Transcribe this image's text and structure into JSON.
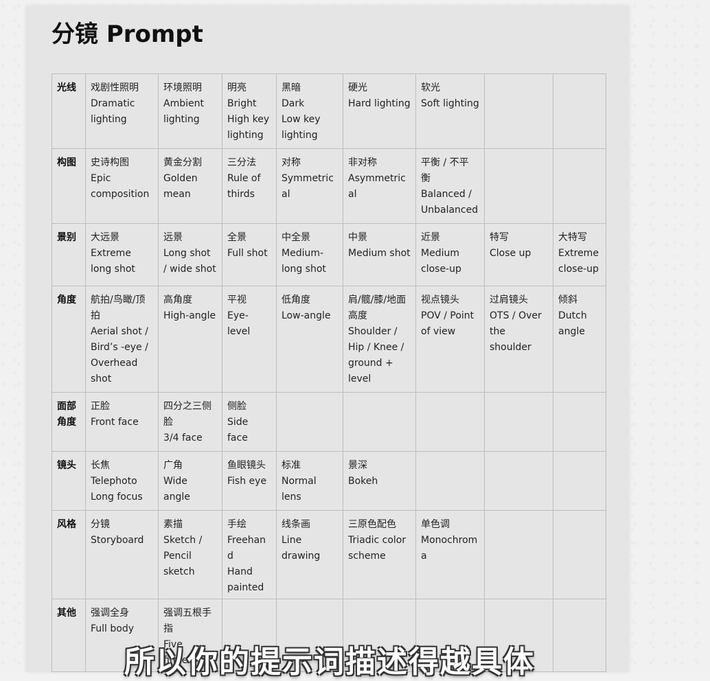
{
  "title": "分镜 Prompt",
  "subtitle": "所以你的提示词描述得越具体",
  "table": {
    "rows": [
      {
        "category": [
          "光线"
        ],
        "cells": [
          [
            "戏剧性照明",
            "Dramatic",
            "lighting"
          ],
          [
            "环境照明",
            "Ambient",
            "lighting"
          ],
          [
            "明亮",
            "Bright",
            "High key",
            "lighting"
          ],
          [
            "黑暗",
            "Dark",
            "Low key",
            "lighting"
          ],
          [
            "硬光",
            "Hard lighting"
          ],
          [
            "软光",
            "Soft lighting"
          ],
          [],
          []
        ]
      },
      {
        "category": [
          "构图"
        ],
        "cells": [
          [
            "史诗构图",
            "Epic",
            "composition"
          ],
          [
            "黄金分割",
            "Golden",
            "mean"
          ],
          [
            "三分法",
            "Rule of",
            "thirds"
          ],
          [
            "对称",
            "Symmetrical"
          ],
          [
            "非对称",
            "Asymmetrical"
          ],
          [
            "平衡 / 不平",
            "衡",
            "Balanced /",
            "Unbalanced"
          ],
          [],
          []
        ]
      },
      {
        "category": [
          "景别"
        ],
        "cells": [
          [
            "大远景",
            "Extreme",
            "long shot"
          ],
          [
            "远景",
            "Long shot",
            "/ wide shot"
          ],
          [
            "全景",
            "Full shot"
          ],
          [
            "中全景",
            "Medium-",
            "long shot"
          ],
          [
            "中景",
            "Medium shot"
          ],
          [
            "近景",
            "Medium",
            "close-up"
          ],
          [
            "特写",
            "Close up"
          ],
          [
            "大特写",
            "Extreme",
            "close-up"
          ]
        ]
      },
      {
        "category": [
          "角度"
        ],
        "cells": [
          [
            "航拍/鸟瞰/顶",
            "拍",
            "Aerial shot /",
            "Bird’s -eye /",
            "Overhead",
            "shot"
          ],
          [
            "高角度",
            "High-angle"
          ],
          [
            "平视",
            "Eye-level"
          ],
          [
            "低角度",
            "Low-angle"
          ],
          [
            "肩/髋/膝/地面",
            "高度",
            "Shoulder /",
            "Hip / Knee /",
            "ground +",
            "level"
          ],
          [
            "视点镜头",
            "POV / Point",
            "of view"
          ],
          [
            "过肩镜头",
            "OTS / Over",
            "the shoulder"
          ],
          [
            "倾斜",
            "Dutch",
            "angle"
          ]
        ]
      },
      {
        "category": [
          "面部",
          "角度"
        ],
        "cells": [
          [
            "正脸",
            "Front face"
          ],
          [
            "四分之三侧",
            "脸",
            "3/4 face"
          ],
          [
            "侧脸",
            "Side face"
          ],
          [],
          [],
          [],
          [],
          []
        ]
      },
      {
        "category": [
          "镜头"
        ],
        "cells": [
          [
            "长焦",
            "Telephoto",
            "Long focus"
          ],
          [
            "广角",
            "Wide angle"
          ],
          [
            "鱼眼镜头",
            "Fish eye"
          ],
          [
            "标准",
            "Normal lens"
          ],
          [
            "景深",
            "Bokeh"
          ],
          [],
          [],
          []
        ]
      },
      {
        "category": [
          "风格"
        ],
        "cells": [
          [
            "分镜",
            "Storyboard"
          ],
          [
            "素描",
            "Sketch /",
            "Pencil",
            "sketch"
          ],
          [
            "手绘",
            "Freehand",
            "Hand",
            "painted"
          ],
          [
            "线条画",
            "Line",
            "drawing"
          ],
          [
            "三原色配色",
            "Triadic color",
            "scheme"
          ],
          [
            "单色调",
            "Monochroma"
          ],
          [],
          []
        ]
      },
      {
        "category": [
          "其他"
        ],
        "cells": [
          [
            "强调全身",
            "Full body"
          ],
          [
            "强调五根手",
            "指",
            "Five fingers"
          ],
          [],
          [],
          [],
          [],
          [],
          []
        ]
      }
    ]
  }
}
